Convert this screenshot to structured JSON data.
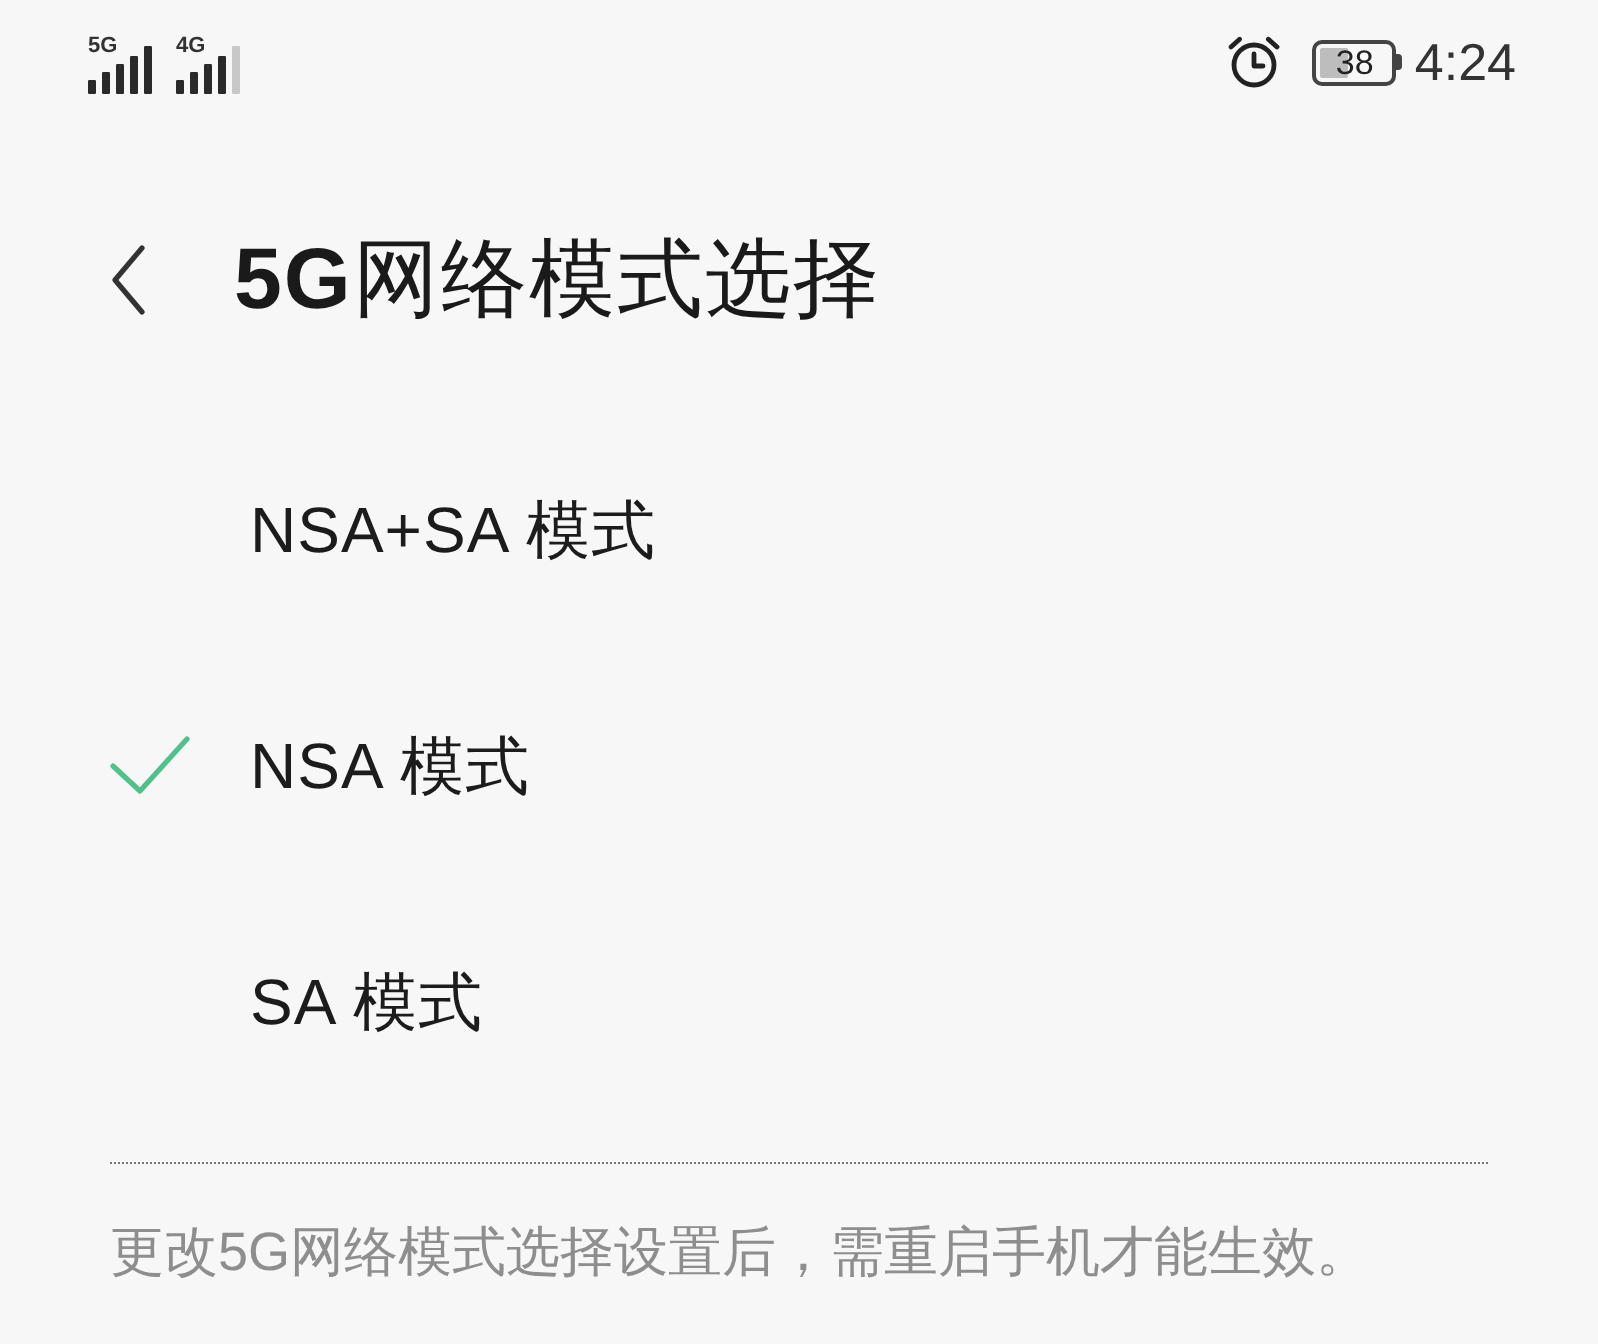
{
  "status_bar": {
    "signals": [
      {
        "label": "5G"
      },
      {
        "label": "4G"
      }
    ],
    "battery": {
      "percentage": "38"
    },
    "time": "4:24"
  },
  "header": {
    "title": "**5G**网络模式选择"
  },
  "options": [
    {
      "label": "NSA+SA 模式",
      "selected": false
    },
    {
      "label": "NSA 模式",
      "selected": true
    },
    {
      "label": "SA 模式",
      "selected": false
    }
  ],
  "note": "更改5G网络模式选择设置后，需重启手机才能生效。"
}
